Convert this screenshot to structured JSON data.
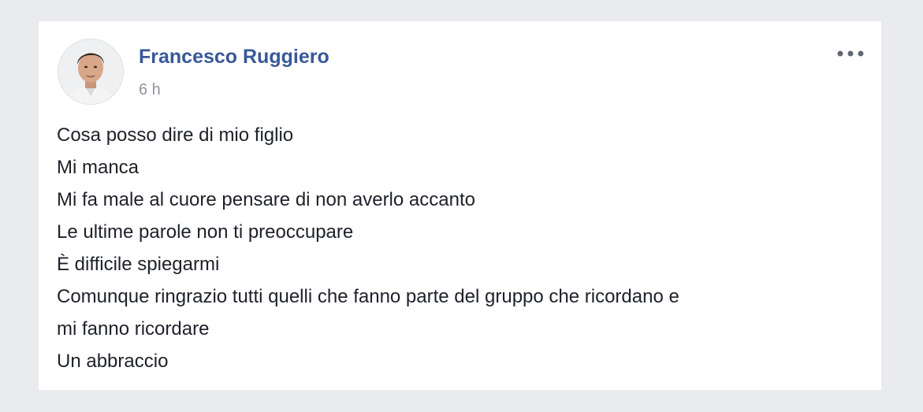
{
  "post": {
    "author": {
      "name": "Francesco Ruggiero",
      "avatar_icon": "profile-photo"
    },
    "timestamp": "6 h",
    "menu_icon": "more-options-icon",
    "lines": [
      "Cosa posso dire di mio figlio",
      "Mi manca",
      "Mi fa male al cuore pensare di non averlo accanto",
      "Le ultime parole non ti preoccupare",
      "È difficile spiegarmi",
      "Comunque ringrazio tutti quelli che fanno parte del gruppo che ricordano e",
      "mi fanno ricordare",
      "Un abbraccio"
    ]
  },
  "colors": {
    "page_background": "#e9ebee",
    "card_background": "#ffffff",
    "author_name": "#385898",
    "timestamp": "#90949c",
    "body_text": "#1d2129"
  }
}
